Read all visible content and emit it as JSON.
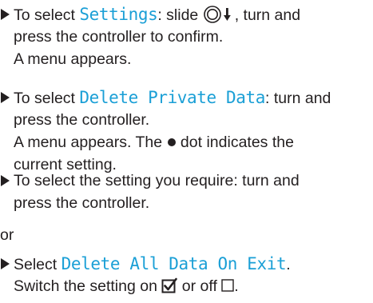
{
  "steps": [
    {
      "line1": {
        "pre": "To select ",
        "ui": "Settings",
        "post": ": slide "
      },
      "line1_after_icon": ", turn and",
      "line2": "press the controller to confirm.",
      "line3": "A menu appears."
    },
    {
      "line1": {
        "pre": "To select ",
        "ui": "Delete Private Data",
        "post": ": turn and"
      },
      "line2": "press the controller.",
      "line3_pre": "A menu appears. The ",
      "line3_post": " dot indicates the",
      "line4": "current setting."
    },
    {
      "line1": "To select the setting you require: turn and",
      "line2": "press the controller."
    },
    {
      "line1": {
        "pre": "Select ",
        "ui": "Delete All Data On Exit",
        "post": "."
      },
      "line2_pre": "Switch the setting on ",
      "line2_mid": " or off ",
      "line2_post": "."
    }
  ],
  "or_label": "or",
  "icons": {
    "bullet": "triangle-right-icon",
    "controller": "controller-slide-down-icon",
    "dot": "filled-dot-icon",
    "checkbox_on": "checkbox-checked-icon",
    "checkbox_off": "checkbox-empty-icon"
  },
  "colors": {
    "text": "#231f20",
    "ui_text": "#1a9fd6"
  }
}
